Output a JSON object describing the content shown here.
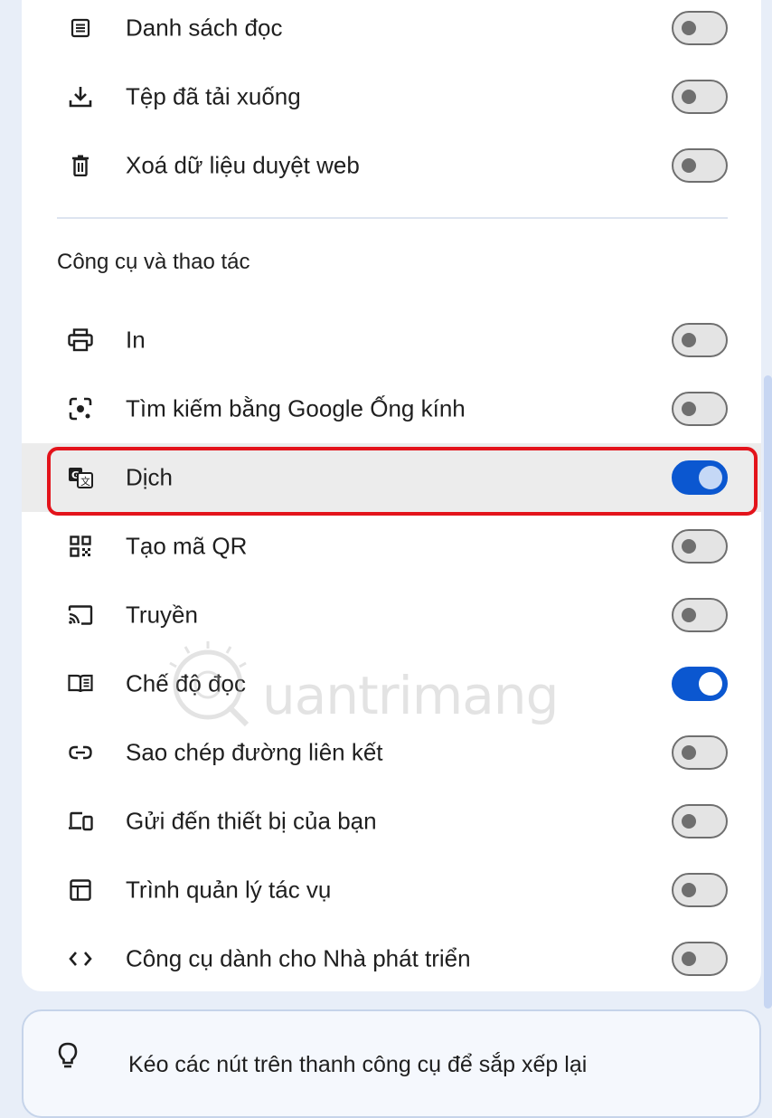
{
  "section": {
    "title": "Công cụ và thao tác"
  },
  "rows": {
    "reading_list": {
      "label": "Danh sách đọc",
      "icon": "reading-list-icon",
      "on": false
    },
    "downloads": {
      "label": "Tệp đã tải xuống",
      "icon": "download-icon",
      "on": false
    },
    "clear_data": {
      "label": "Xoá dữ liệu duyệt web",
      "icon": "trash-icon",
      "on": false
    },
    "print": {
      "label": "In",
      "icon": "printer-icon",
      "on": false
    },
    "lens": {
      "label": "Tìm kiếm bằng Google Ống kính",
      "icon": "google-lens-icon",
      "on": false
    },
    "translate": {
      "label": "Dịch",
      "icon": "translate-icon",
      "on": true
    },
    "qr": {
      "label": "Tạo mã QR",
      "icon": "qr-code-icon",
      "on": false
    },
    "cast": {
      "label": "Truyền",
      "icon": "cast-icon",
      "on": false
    },
    "reading_mode": {
      "label": "Chế độ đọc",
      "icon": "reading-mode-icon",
      "on": true
    },
    "copy_link": {
      "label": "Sao chép đường liên kết",
      "icon": "link-icon",
      "on": false
    },
    "send_device": {
      "label": "Gửi đến thiết bị của bạn",
      "icon": "devices-icon",
      "on": false
    },
    "task_manager": {
      "label": "Trình quản lý tác vụ",
      "icon": "task-manager-icon",
      "on": false
    },
    "dev_tools": {
      "label": "Công cụ dành cho Nhà phát triển",
      "icon": "code-icon",
      "on": false
    }
  },
  "tip": {
    "text": "Kéo các nút trên thanh công cụ để sắp xếp lại",
    "icon": "lightbulb-icon"
  },
  "watermark": {
    "text": "uantrimang",
    "logo": "quantrimang-logo"
  },
  "colors": {
    "accent": "#0b57d0",
    "highlight": "#e3131b",
    "toggle_off": "#6f6f6f"
  }
}
